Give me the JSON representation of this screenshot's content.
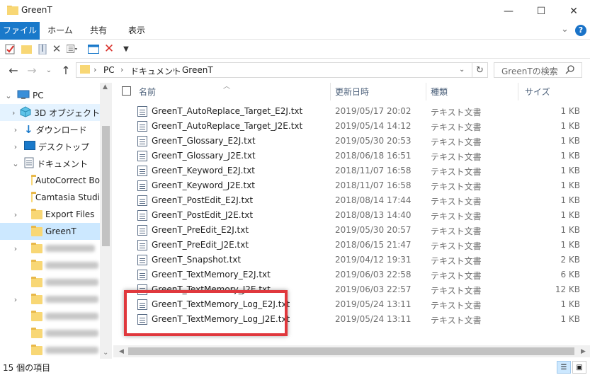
{
  "window": {
    "title": "GreenT",
    "controls": {
      "minimize": "—",
      "maximize": "☐",
      "close": "✕"
    }
  },
  "ribbon": {
    "tabs": [
      "ファイル",
      "ホーム",
      "共有",
      "表示"
    ],
    "expand_glyph": "⌄",
    "help_glyph": "?"
  },
  "qat": {
    "icons": [
      "properties-icon",
      "new-folder-icon",
      "zip-icon",
      "delete-x-icon",
      "view-options-icon",
      "window-icon",
      "red-delete-icon",
      "customize-qat-icon"
    ]
  },
  "address": {
    "crumbs": [
      "PC",
      "ドキュメント",
      "GreenT"
    ],
    "search_placeholder": "GreenTの検索"
  },
  "navpane": {
    "items": [
      {
        "label": "PC",
        "icon": "pc-icon"
      },
      {
        "label": "3D オブジェクト",
        "icon": "3d-objects-icon"
      },
      {
        "label": "ダウンロード",
        "icon": "download-icon"
      },
      {
        "label": "デスクトップ",
        "icon": "desktop-icon"
      },
      {
        "label": "ドキュメント",
        "icon": "documents-icon"
      },
      {
        "label": "AutoCorrect Bo",
        "icon": "folder-icon"
      },
      {
        "label": "Camtasia Studi",
        "icon": "folder-icon"
      },
      {
        "label": "Export Files",
        "icon": "folder-icon"
      },
      {
        "label": "GreenT",
        "icon": "folder-icon"
      }
    ]
  },
  "columns": {
    "name": "名前",
    "date": "更新日時",
    "type": "種類",
    "size": "サイズ"
  },
  "files": [
    {
      "name": "GreenT_AutoReplace_Target_E2J.txt",
      "date": "2019/05/17 20:02",
      "type": "テキスト文書",
      "size": "1 KB"
    },
    {
      "name": "GreenT_AutoReplace_Target_J2E.txt",
      "date": "2019/05/14 14:12",
      "type": "テキスト文書",
      "size": "1 KB"
    },
    {
      "name": "GreenT_Glossary_E2J.txt",
      "date": "2019/05/30 20:53",
      "type": "テキスト文書",
      "size": "1 KB"
    },
    {
      "name": "GreenT_Glossary_J2E.txt",
      "date": "2018/06/18 16:51",
      "type": "テキスト文書",
      "size": "1 KB"
    },
    {
      "name": "GreenT_Keyword_E2J.txt",
      "date": "2018/11/07 16:58",
      "type": "テキスト文書",
      "size": "1 KB"
    },
    {
      "name": "GreenT_Keyword_J2E.txt",
      "date": "2018/11/07 16:58",
      "type": "テキスト文書",
      "size": "1 KB"
    },
    {
      "name": "GreenT_PostEdit_E2J.txt",
      "date": "2018/08/14 17:44",
      "type": "テキスト文書",
      "size": "1 KB"
    },
    {
      "name": "GreenT_PostEdit_J2E.txt",
      "date": "2018/08/13 14:40",
      "type": "テキスト文書",
      "size": "1 KB"
    },
    {
      "name": "GreenT_PreEdit_E2J.txt",
      "date": "2019/05/30 20:57",
      "type": "テキスト文書",
      "size": "1 KB"
    },
    {
      "name": "GreenT_PreEdit_J2E.txt",
      "date": "2018/06/15 21:47",
      "type": "テキスト文書",
      "size": "1 KB"
    },
    {
      "name": "GreenT_Snapshot.txt",
      "date": "2019/04/12 19:31",
      "type": "テキスト文書",
      "size": "2 KB"
    },
    {
      "name": "GreenT_TextMemory_E2J.txt",
      "date": "2019/06/03 22:58",
      "type": "テキスト文書",
      "size": "6 KB"
    },
    {
      "name": "GreenT_TextMemory_J2E.txt",
      "date": "2019/06/03 22:57",
      "type": "テキスト文書",
      "size": "12 KB"
    },
    {
      "name": "GreenT_TextMemory_Log_E2J.txt",
      "date": "2019/05/24 13:11",
      "type": "テキスト文書",
      "size": "1 KB"
    },
    {
      "name": "GreenT_TextMemory_Log_J2E.txt",
      "date": "2019/05/24 13:11",
      "type": "テキスト文書",
      "size": "1 KB"
    }
  ],
  "status": {
    "item_count": "15 個の項目"
  },
  "colors": {
    "accent": "#1979ca",
    "selection": "#cce8ff",
    "highlight_border": "#e0383d",
    "folder": "#f8d775"
  }
}
